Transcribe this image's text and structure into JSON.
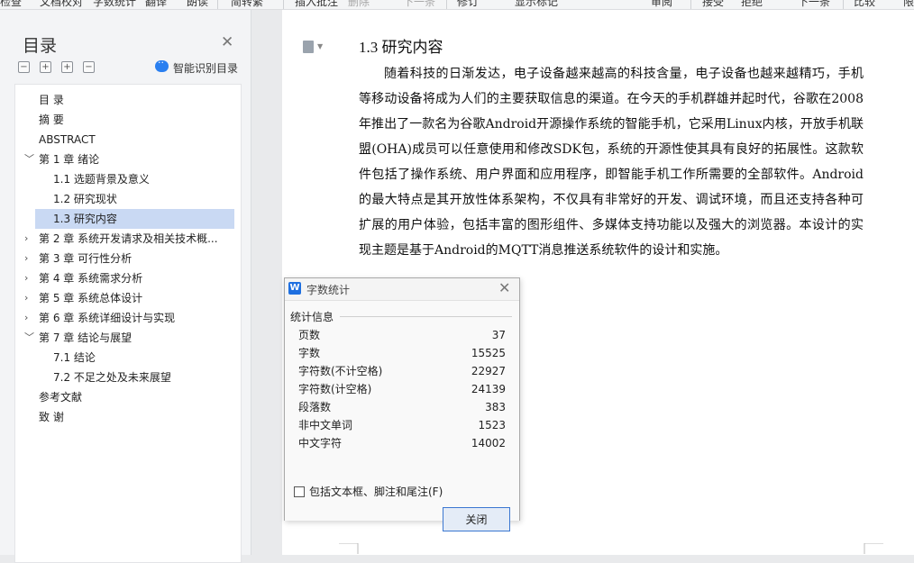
{
  "toolbar": {
    "items": [
      "检查",
      "文档校对",
      "字数统计",
      "翻译",
      "朗读",
      "简转繁",
      "插入批注",
      "删除",
      "下一条",
      "修订",
      "显示标记",
      "审阅",
      "接受",
      "拒绝",
      "下一条",
      "比较",
      "限"
    ]
  },
  "toc": {
    "title": "目录",
    "smart_label": "智能识别目录",
    "controls": [
      "−",
      "+",
      "+",
      "−"
    ],
    "items": [
      {
        "label": "目  录",
        "expander": ""
      },
      {
        "label": "摘  要",
        "expander": ""
      },
      {
        "label": "ABSTRACT",
        "expander": ""
      },
      {
        "label": "第 1 章  绪论",
        "expander": "v"
      },
      {
        "label": "1.1  选题背景及意义",
        "expander": ""
      },
      {
        "label": "1.2  研究现状",
        "expander": ""
      },
      {
        "label": "1.3  研究内容",
        "expander": ""
      },
      {
        "label": "第 2 章  系统开发请求及相关技术概...",
        "expander": ">"
      },
      {
        "label": "第 3 章  可行性分析",
        "expander": ">"
      },
      {
        "label": "第 4 章  系统需求分析",
        "expander": ">"
      },
      {
        "label": "第 5 章  系统总体设计",
        "expander": ">"
      },
      {
        "label": "第 6 章  系统详细设计与实现",
        "expander": ">"
      },
      {
        "label": "第 7 章  结论与展望",
        "expander": "v"
      },
      {
        "label": "7.1  结论",
        "expander": ""
      },
      {
        "label": "7.2  不足之处及未来展望",
        "expander": ""
      },
      {
        "label": "参考文献",
        "expander": ""
      },
      {
        "label": "致  谢",
        "expander": ""
      }
    ],
    "selected_index": 6
  },
  "document": {
    "heading": "1.3  研究内容",
    "paragraph_lines": [
      "随着科技的日渐发达，电子设备越来越高的科技含量，电子设备也越来越精巧，手机",
      "等移动设备将成为人们的主要获取信息的渠道。在今天的手机群雄并起时代，谷歌在2008",
      "年推出了一款名为谷歌Android开源操作系统的智能手机，它采用Linux内核，开放手机联",
      "盟(OHA)成员可以任意使用和修改SDK包，系统的开源性使其具有良好的拓展性。这款软",
      "件包括了操作系统、用户界面和应用程序，即智能手机工作所需要的全部软件。Android",
      "的最大特点是其开放性体系架构，不仅具有非常好的开发、调试环境，而且还支持各种可",
      "扩展的用户体验，包括丰富的图形组件、多媒体支持功能以及强大的浏览器。本设计的实",
      "现主题是基于Android的MQTT消息推送系统软件的设计和实施。"
    ]
  },
  "dialog": {
    "title": "字数统计",
    "group_label": "统计信息",
    "stats": [
      {
        "label": "页数",
        "value": "37"
      },
      {
        "label": "字数",
        "value": "15525"
      },
      {
        "label": "字符数(不计空格)",
        "value": "22927"
      },
      {
        "label": "字符数(计空格)",
        "value": "24139"
      },
      {
        "label": "段落数",
        "value": "383"
      },
      {
        "label": "非中文单词",
        "value": "1523"
      },
      {
        "label": "中文字符",
        "value": "14002"
      }
    ],
    "checkbox_label": "包括文本框、脚注和尾注(F)",
    "close_label": "关闭"
  },
  "colors": {
    "selection": "#c9d9f3",
    "accent": "#2a7ff0",
    "button_border": "#3b77d1"
  }
}
